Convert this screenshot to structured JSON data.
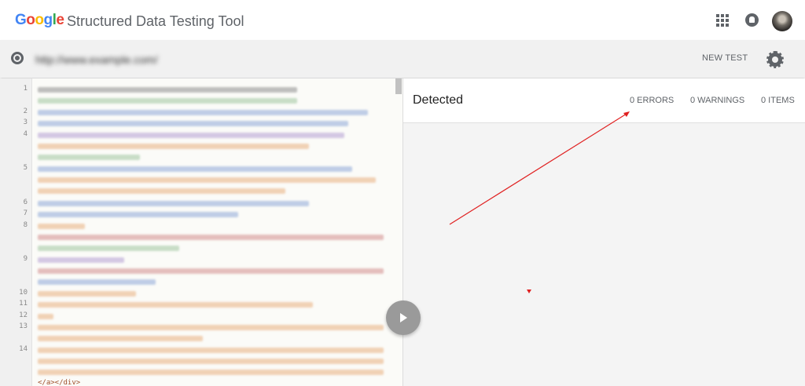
{
  "header": {
    "logo": {
      "letters": [
        "G",
        "o",
        "o",
        "g",
        "l",
        "e"
      ],
      "colors": [
        "#4285F4",
        "#EA4335",
        "#FBBC05",
        "#4285F4",
        "#34A853",
        "#EA4335"
      ]
    },
    "title": "Structured Data Testing Tool",
    "icons": [
      "apps-grid-icon",
      "notifications-icon",
      "avatar"
    ]
  },
  "urlbar": {
    "icon": "globe-icon",
    "url": "http://www.example.com/",
    "new_test_label": "NEW TEST",
    "settings_icon": "gear-icon"
  },
  "editor": {
    "line_numbers": [
      "1",
      "2",
      "3",
      "4",
      "5",
      "6",
      "7",
      "8",
      "9",
      "10",
      "11",
      "12",
      "13",
      "14"
    ],
    "tail_text": "</a></div>",
    "run_icon": "play-icon"
  },
  "results": {
    "title": "Detected",
    "errors_label": "0 ERRORS",
    "warnings_label": "0 WARNINGS",
    "items_label": "0 ITEMS"
  },
  "colors": {
    "annotation": "#e02020",
    "brand_gray": "#5f6368"
  }
}
